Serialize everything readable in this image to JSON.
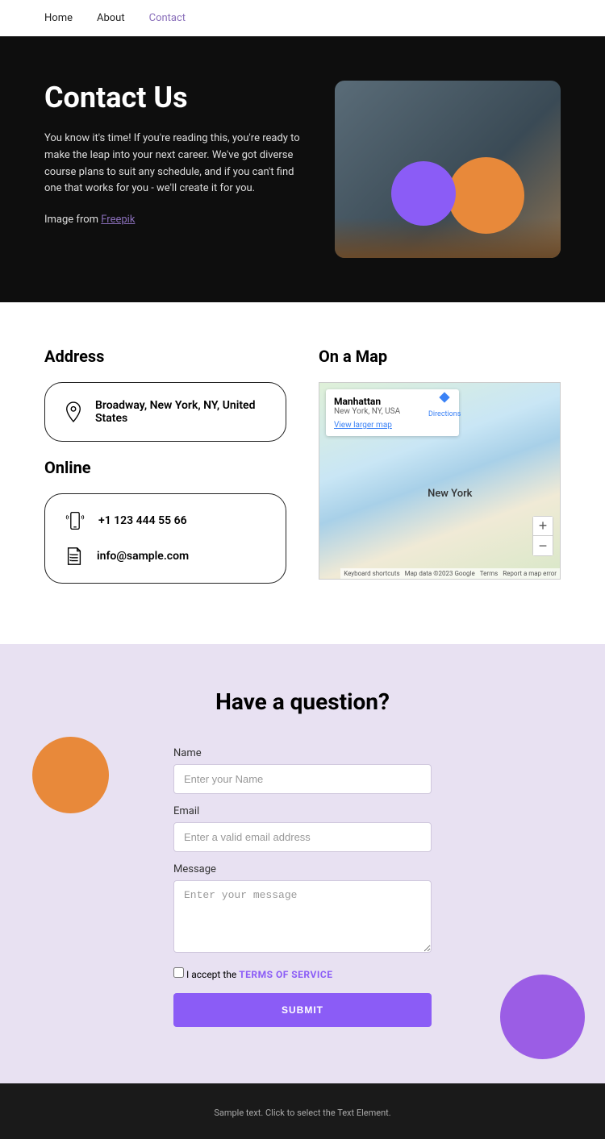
{
  "nav": {
    "home": "Home",
    "about": "About",
    "contact": "Contact"
  },
  "hero": {
    "title": "Contact Us",
    "body": "You know it's time! If you're reading this, you're ready to make the leap into your next career. We've got diverse course plans to suit any schedule, and if you can't find one that works for you - we'll create it for you.",
    "image_prefix": "Image from ",
    "image_link": "Freepik"
  },
  "address": {
    "heading": "Address",
    "text": "Broadway, New York, NY, United States"
  },
  "online": {
    "heading": "Online",
    "phone": "+1 123 444 55 66",
    "email": "info@sample.com"
  },
  "map": {
    "heading": "On a Map",
    "card_title": "Manhattan",
    "card_sub": "New York, NY, USA",
    "view_larger": "View larger map",
    "directions": "Directions",
    "center_label": "New York",
    "footer_shortcuts": "Keyboard shortcuts",
    "footer_data": "Map data ©2023 Google",
    "footer_terms": "Terms",
    "footer_report": "Report a map error"
  },
  "form": {
    "heading": "Have a question?",
    "name_label": "Name",
    "name_placeholder": "Enter your Name",
    "email_label": "Email",
    "email_placeholder": "Enter a valid email address",
    "message_label": "Message",
    "message_placeholder": "Enter your message",
    "accept_prefix": "I accept the ",
    "tos": "TERMS OF SERVICE",
    "submit": "SUBMIT"
  },
  "footer": {
    "text": "Sample text. Click to select the Text Element."
  }
}
